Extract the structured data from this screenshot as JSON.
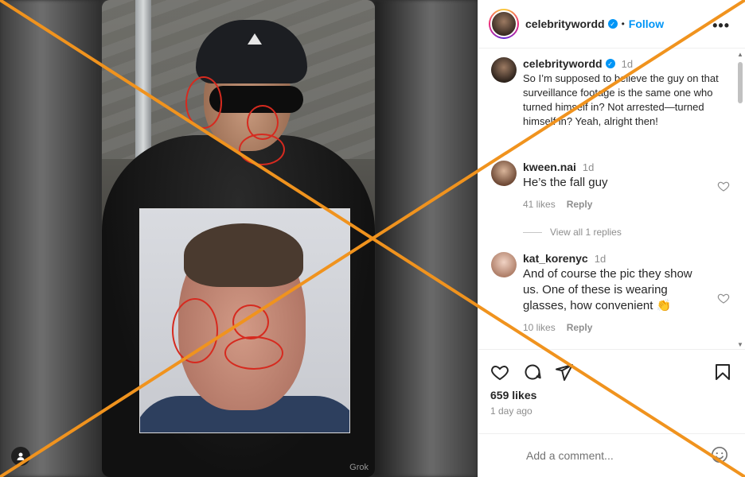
{
  "post": {
    "username": "celebritywordd",
    "verified": true,
    "follow_label": "Follow",
    "dot": "•",
    "more_label": "•••",
    "watermark": "Grok"
  },
  "caption": {
    "username": "celebritywordd",
    "time": "1d",
    "text": "So I’m supposed to believe the guy on that surveillance footage is the same one who turned himself in? Not arrested—turned himself in? Yeah, alright then!"
  },
  "comments": [
    {
      "username": "kween.nai",
      "time": "1d",
      "text": "He’s the fall guy",
      "likes": "41 likes",
      "reply_label": "Reply"
    },
    {
      "username": "kat_korenyc",
      "time": "1d",
      "text": "And of course the pic they show us. One of these is wearing glasses, how convenient 👏",
      "likes": "10 likes",
      "reply_label": "Reply"
    }
  ],
  "view_replies": "View all 1 replies",
  "stats": {
    "likes": "659 likes",
    "date": "1 day ago"
  },
  "add_comment": {
    "placeholder": "Add a comment..."
  },
  "icons": [
    "heart-icon",
    "comment-icon",
    "share-icon",
    "save-icon",
    "emoji-icon",
    "more-icon",
    "verified-icon",
    "profile-tag-icon"
  ],
  "colors": {
    "accent": "#0095f6",
    "overlay_x": "#f0931e",
    "markup_red": "#d62a1f"
  }
}
